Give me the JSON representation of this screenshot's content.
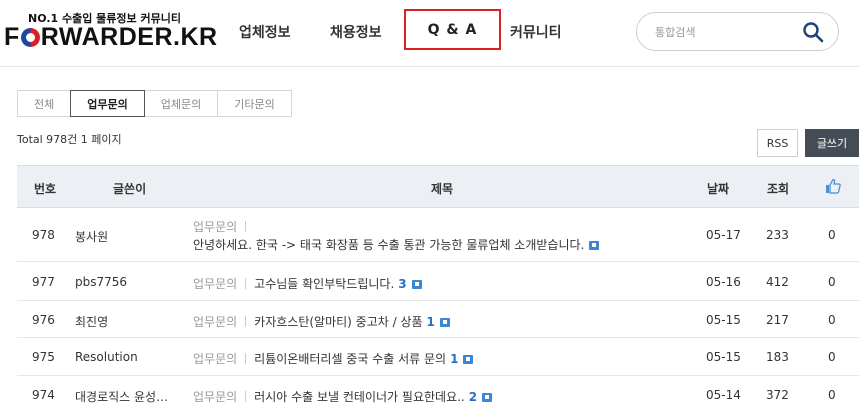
{
  "header": {
    "tagline": "NO.1 수출입 물류정보 커뮤니티",
    "brand_pre": "F",
    "brand_post": "RWARDER.KR",
    "nav": [
      "업체정보",
      "채용정보",
      "Q & A",
      "커뮤니티"
    ],
    "search_placeholder": "통합검색"
  },
  "tabs": [
    "전체",
    "업무문의",
    "업체문의",
    "기타문의"
  ],
  "active_tab": "업무문의",
  "total_text": "Total 978건  1 페이지",
  "buttons": {
    "rss": "RSS",
    "write": "글쓰기"
  },
  "table": {
    "headers": {
      "num": "번호",
      "author": "글쓴이",
      "title": "제목",
      "date": "날짜",
      "views": "조회"
    },
    "rows": [
      {
        "num": "978",
        "author": "봉사원",
        "category": "업무문의",
        "title": "안녕하세요. 한국 -> 태국 화장품 등 수출 통관 가능한 물류업체 소개받습니다.",
        "comments": "",
        "date": "05-17",
        "views": "233",
        "likes": "0"
      },
      {
        "num": "977",
        "author": "pbs7756",
        "category": "업무문의",
        "title": "고수님들 확인부탁드립니다.",
        "comments": "3",
        "date": "05-16",
        "views": "412",
        "likes": "0"
      },
      {
        "num": "976",
        "author": "최진영",
        "category": "업무문의",
        "title": "카자흐스탄(알마티) 중고차 / 상품",
        "comments": "1",
        "date": "05-15",
        "views": "217",
        "likes": "0"
      },
      {
        "num": "975",
        "author": "Resolution",
        "category": "업무문의",
        "title": "리튬이온배터리셀 중국 수출 서류 문의",
        "comments": "1",
        "date": "05-15",
        "views": "183",
        "likes": "0"
      },
      {
        "num": "974",
        "author": "대경로직스 윤성…",
        "category": "업무문의",
        "title": "러시아 수출 보낼 컨테이너가 필요한데요..",
        "comments": "2",
        "date": "05-14",
        "views": "372",
        "likes": "0"
      }
    ]
  },
  "colors": {
    "highlight_border": "#e02020",
    "accent_blue": "#2a6fc9",
    "write_button": "#444c56"
  }
}
